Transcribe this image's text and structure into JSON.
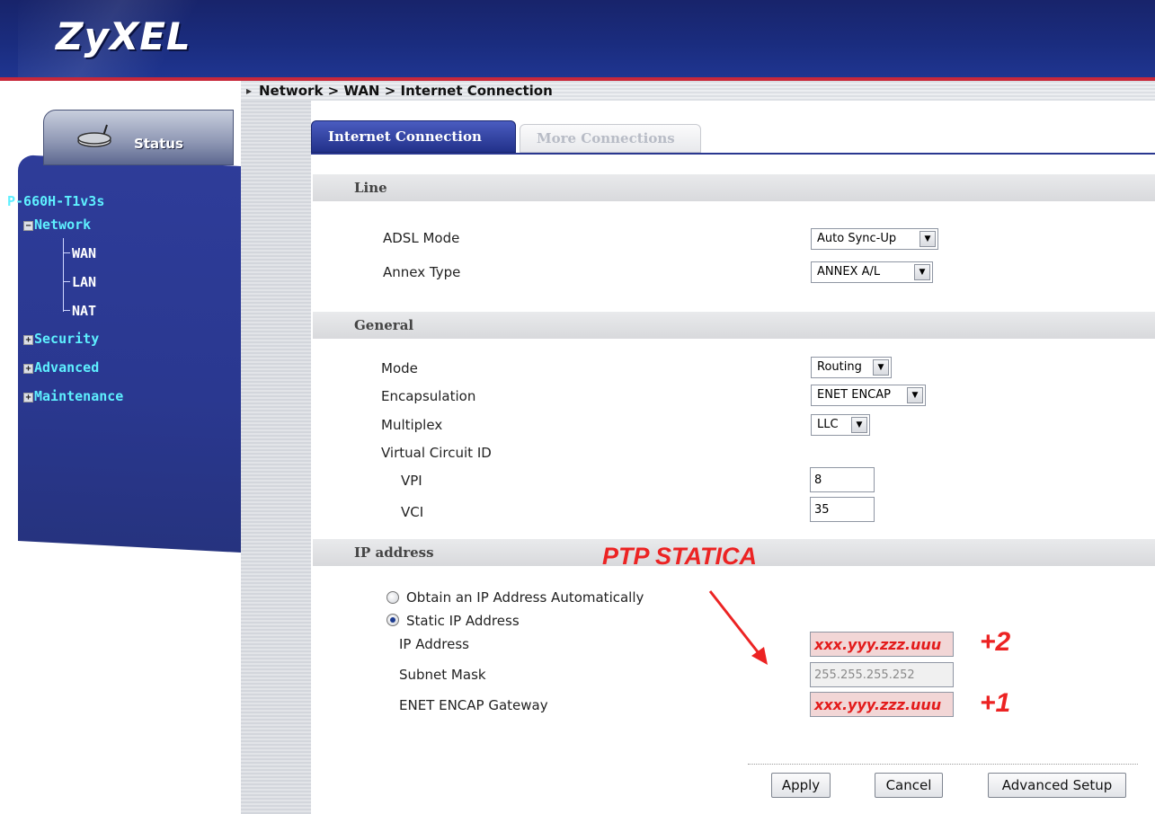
{
  "header": {
    "logo": "ZyXEL"
  },
  "sidebar": {
    "status_tab": "Status",
    "model": "P-660H-T1v3s",
    "network": "Network",
    "network_items": [
      "WAN",
      "LAN",
      "NAT"
    ],
    "security": "Security",
    "advanced": "Advanced",
    "maintenance": "Maintenance"
  },
  "breadcrumb": "Network > WAN > Internet Connection",
  "tabs": [
    {
      "label": "Internet Connection",
      "active": true
    },
    {
      "label": "More Connections",
      "active": false
    }
  ],
  "line": {
    "title": "Line",
    "adsl_mode_label": "ADSL Mode",
    "adsl_mode_value": "Auto Sync-Up",
    "annex_type_label": "Annex Type",
    "annex_type_value": "ANNEX A/L"
  },
  "general": {
    "title": "General",
    "mode_label": "Mode",
    "mode_value": "Routing",
    "encapsulation_label": "Encapsulation",
    "encapsulation_value": "ENET ENCAP",
    "multiplex_label": "Multiplex",
    "multiplex_value": "LLC",
    "vcid_label": "Virtual Circuit ID",
    "vpi_label": "VPI",
    "vpi_value": "8",
    "vci_label": "VCI",
    "vci_value": "35"
  },
  "ip": {
    "title": "IP address",
    "obtain_auto_label": "Obtain an IP Address Automatically",
    "static_label": "Static IP Address",
    "selected": "static",
    "ip_address_label": "IP Address",
    "ip_address_value": "xxx.yyy.zzz.uuu",
    "subnet_mask_label": "Subnet Mask",
    "subnet_mask_value": "255.255.255.252",
    "gateway_label": "ENET ENCAP Gateway",
    "gateway_value": "xxx.yyy.zzz.uuu"
  },
  "annotations": {
    "title": "PTP STATICA",
    "ip_offset": "+2",
    "gateway_offset": "+1",
    "color": "#ec2323"
  },
  "buttons": {
    "apply": "Apply",
    "cancel": "Cancel",
    "advanced_setup": "Advanced Setup"
  },
  "colors": {
    "header_bg": "#1a2c7e",
    "accent_red": "#c8283a",
    "nav_text": "#5ef0ff",
    "active_tab": "#22318a"
  }
}
